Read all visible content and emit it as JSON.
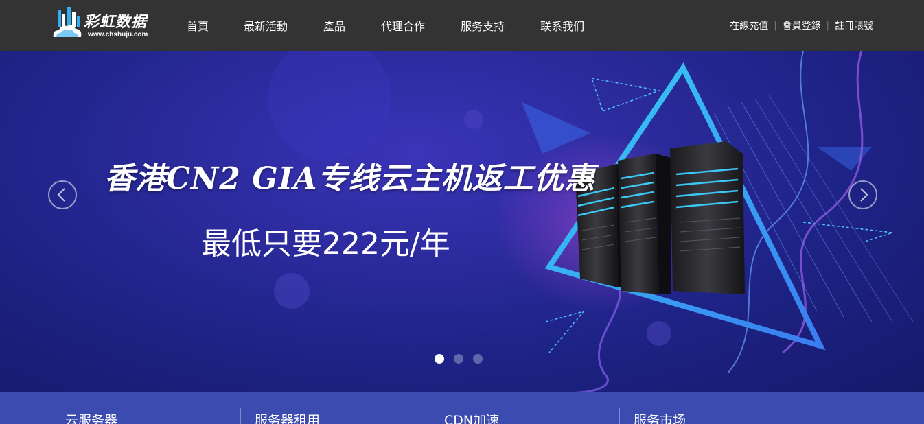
{
  "logo": {
    "name": "彩虹数据",
    "url": "www.chshuju.com",
    "icon": "city-cloud-icon"
  },
  "nav": [
    "首頁",
    "最新活動",
    "產品",
    "代理合作",
    "服务支持",
    "联系我们"
  ],
  "user_links": [
    "在線充值",
    "會員登錄",
    "註冊賬號"
  ],
  "banner": {
    "headline": "香港CN2 GIA专线云主机返工优惠",
    "subline": "最低只要222元/年",
    "slides": 3,
    "active_slide": 1
  },
  "categories": [
    "云服务器",
    "服务器租用",
    "CDN加速",
    "服务市场"
  ],
  "colors": {
    "header": "#333333",
    "banner": "#2a2a9a",
    "category_bar": "#3c4bb0",
    "accent": "#39c8f0"
  }
}
